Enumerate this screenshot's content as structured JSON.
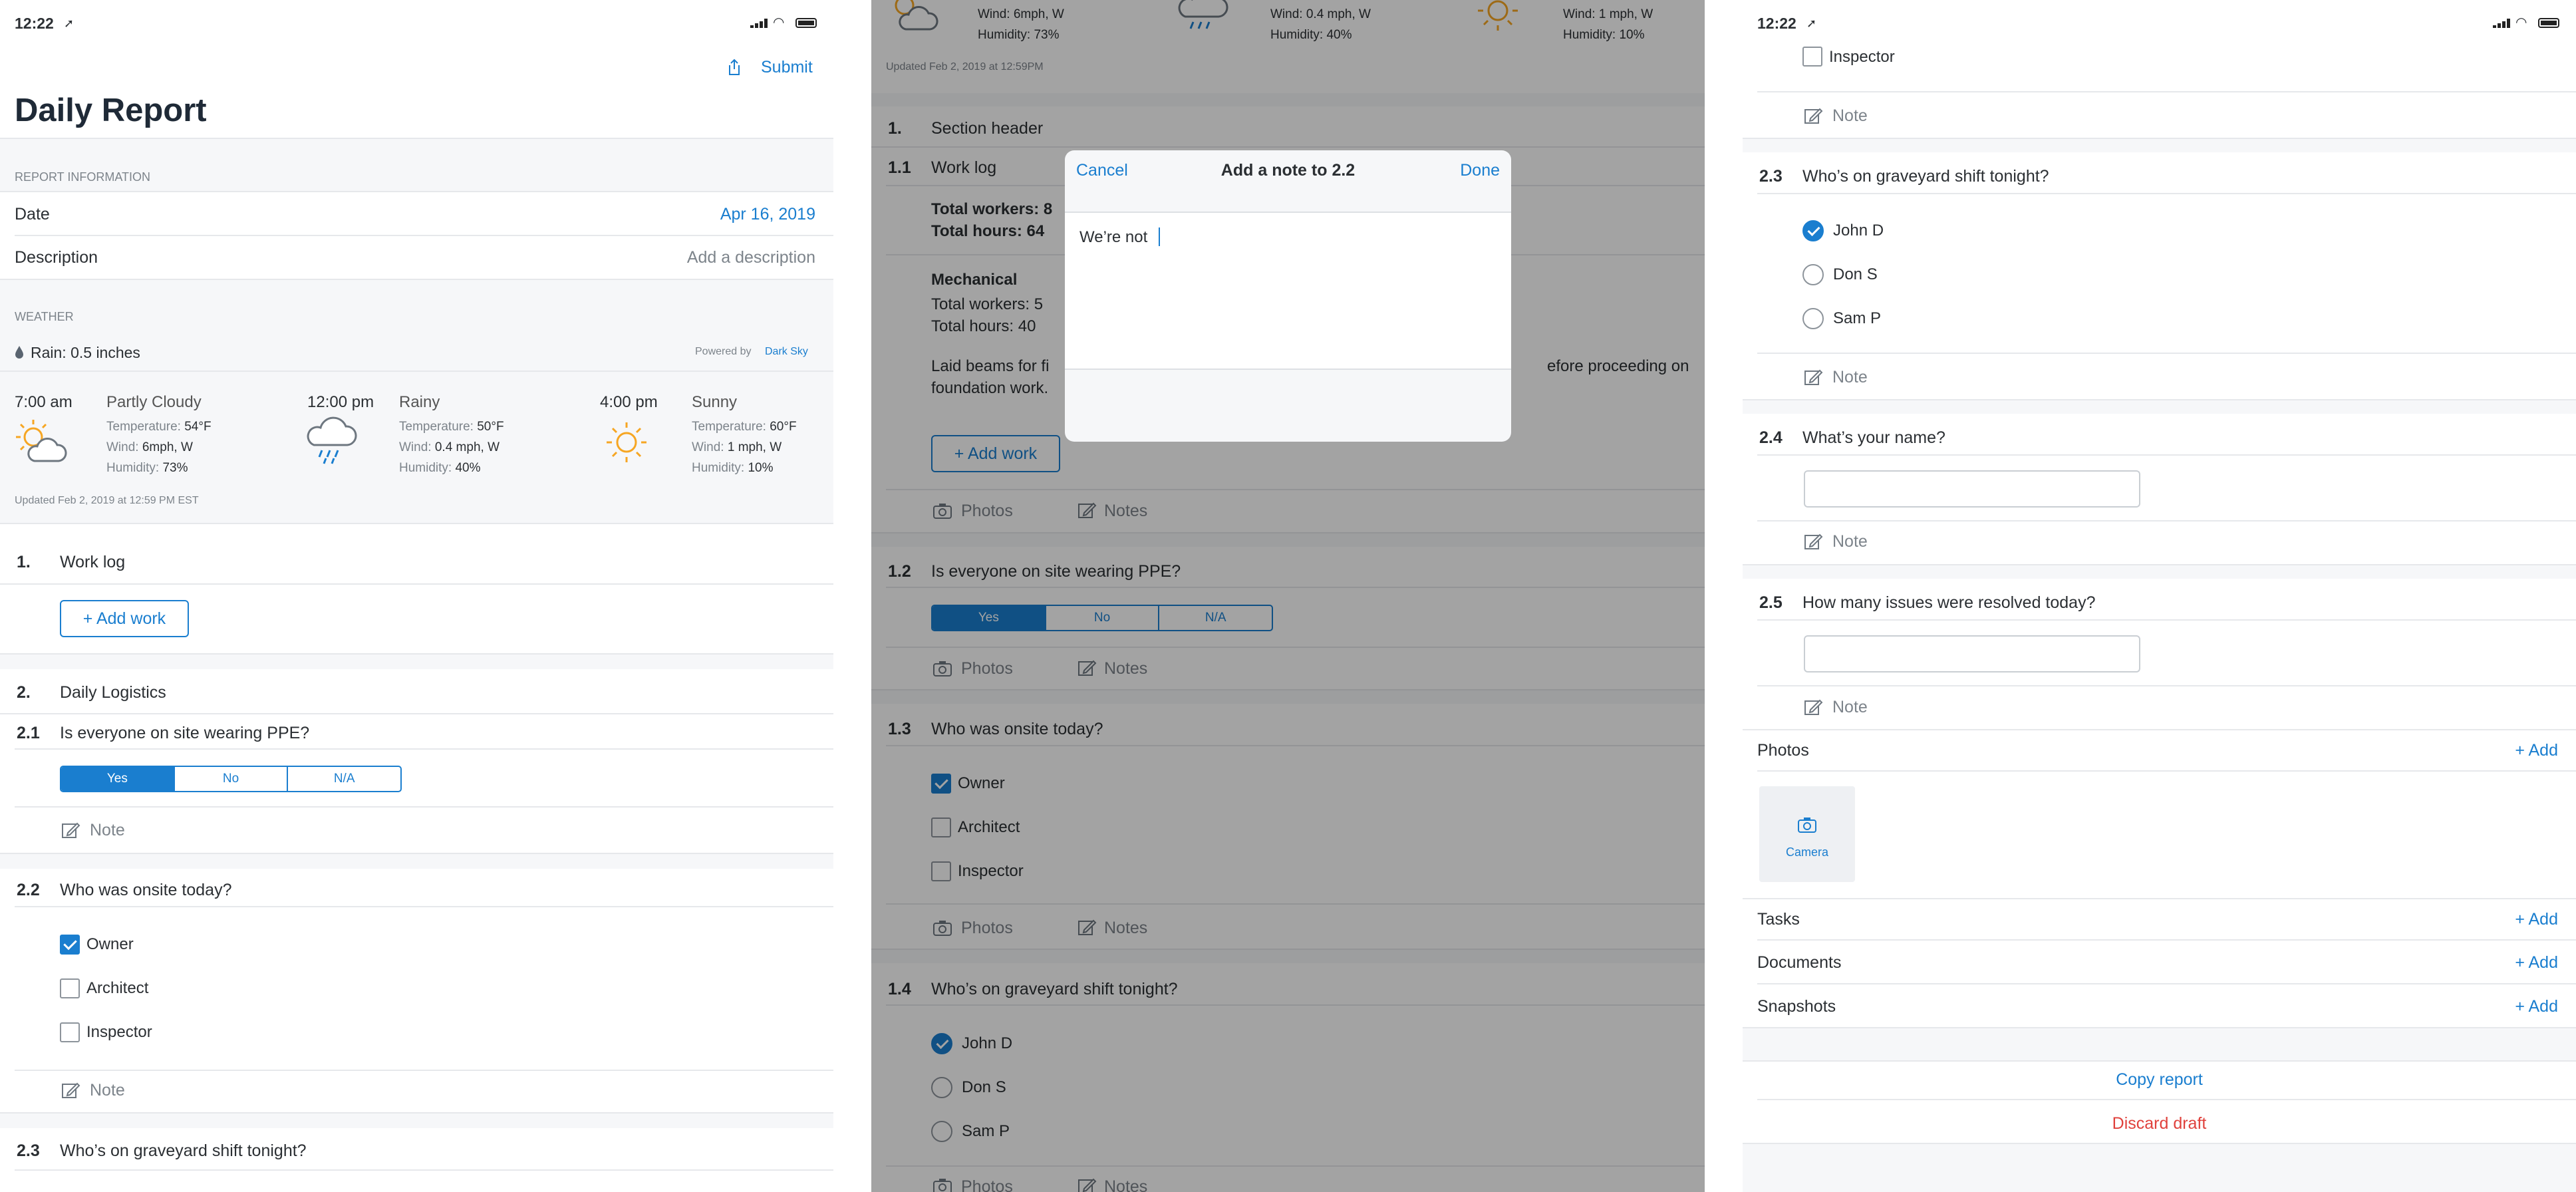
{
  "colors": {
    "accent": "#1a7ecf",
    "danger": "#e0413c",
    "section_bg": "#f6f7f9"
  },
  "status": {
    "time": "12:22"
  },
  "left": {
    "submit": "Submit",
    "title": "Daily Report",
    "report_info_header": "REPORT INFORMATION",
    "date_label": "Date",
    "date_value": "Apr 16, 2019",
    "description_label": "Description",
    "description_placeholder": "Add a description",
    "weather_header": "WEATHER",
    "rain": "Rain: 0.5 inches",
    "powered_by": "Powered by",
    "powered_link": "Dark Sky",
    "forecasts": [
      {
        "time": "7:00 am",
        "condition": "Partly Cloudy",
        "icon": "partly-cloudy-icon",
        "temp": "54°F",
        "wind": "6mph, W",
        "humidity": "73%"
      },
      {
        "time": "12:00 pm",
        "condition": "Rainy",
        "icon": "rain-cloud-icon",
        "temp": "50°F",
        "wind": "0.4 mph, W",
        "humidity": "40%"
      },
      {
        "time": "4:00 pm",
        "condition": "Sunny",
        "icon": "sun-icon",
        "temp": "60°F",
        "wind": "1 mph, W",
        "humidity": "10%"
      }
    ],
    "field_labels": {
      "temperature": "Temperature:",
      "wind": "Wind:",
      "humidity": "Humidity:"
    },
    "updated": "Updated Feb 2, 2019 at 12:59 PM EST",
    "s1_num": "1.",
    "s1_title": "Work log",
    "add_work": "+ Add work",
    "s2_num": "2.",
    "s2_title": "Daily Logistics",
    "q21_num": "2.1",
    "q21_text": "Is everyone on site wearing PPE?",
    "seg": [
      "Yes",
      "No",
      "N/A"
    ],
    "note": "Note",
    "q22_num": "2.2",
    "q22_text": "Who was onsite today?",
    "onsite": [
      {
        "label": "Owner",
        "checked": true
      },
      {
        "label": "Architect",
        "checked": false
      },
      {
        "label": "Inspector",
        "checked": false
      }
    ],
    "q23_num": "2.3",
    "q23_text": "Who’s on graveyard shift tonight?"
  },
  "middle": {
    "top_wind": [
      "Wind: 6mph, W",
      "Wind: 0.4 mph, W",
      "Wind: 1 mph, W"
    ],
    "top_humidity": [
      "Humidity: 73%",
      "Humidity: 40%",
      "Humidity: 10%"
    ],
    "updated": "Updated Feb 2, 2019 at 12:59PM",
    "s1_num": "1.",
    "s1_title": "Section header",
    "q11_num": "1.1",
    "q11_text": "Work log",
    "total_workers_a": "Total workers: 8",
    "total_hours_a": "Total hours: 64",
    "mech_title": "Mechanical",
    "total_workers_b": "Total workers: 5",
    "total_hours_b": "Total hours: 40",
    "notes_text_left": "Laid beams for fi",
    "notes_text_right": "efore proceeding on",
    "notes_text_line2": "foundation work.",
    "add_work": "+ Add work",
    "photos": "Photos",
    "notes": "Notes",
    "q12_num": "1.2",
    "q12_text": "Is everyone on site wearing PPE?",
    "seg": [
      "Yes",
      "No",
      "N/A"
    ],
    "q13_num": "1.3",
    "q13_text": "Who was onsite today?",
    "onsite": [
      {
        "label": "Owner",
        "checked": true
      },
      {
        "label": "Architect",
        "checked": false
      },
      {
        "label": "Inspector",
        "checked": false
      }
    ],
    "q14_num": "1.4",
    "q14_text": "Who’s on graveyard shift tonight?",
    "shift": [
      {
        "label": "John D",
        "checked": true
      },
      {
        "label": "Don S",
        "checked": false
      },
      {
        "label": "Sam P",
        "checked": false
      }
    ],
    "modal": {
      "cancel": "Cancel",
      "title": "Add a note to 2.2",
      "done": "Done",
      "text": "We’re not"
    }
  },
  "right": {
    "inspector": "Inspector",
    "note": "Note",
    "q23_num": "2.3",
    "q23_text": "Who’s on graveyard shift tonight?",
    "shift": [
      {
        "label": "John D",
        "checked": true
      },
      {
        "label": "Don S",
        "checked": false
      },
      {
        "label": "Sam P",
        "checked": false
      }
    ],
    "q24_num": "2.4",
    "q24_text": "What’s your name?",
    "q25_num": "2.5",
    "q25_text": "How many issues were resolved today?",
    "photos": "Photos",
    "add": "+ Add",
    "camera": "Camera",
    "tasks": "Tasks",
    "documents": "Documents",
    "snapshots": "Snapshots",
    "copy_report": "Copy report",
    "discard_draft": "Discard draft"
  }
}
